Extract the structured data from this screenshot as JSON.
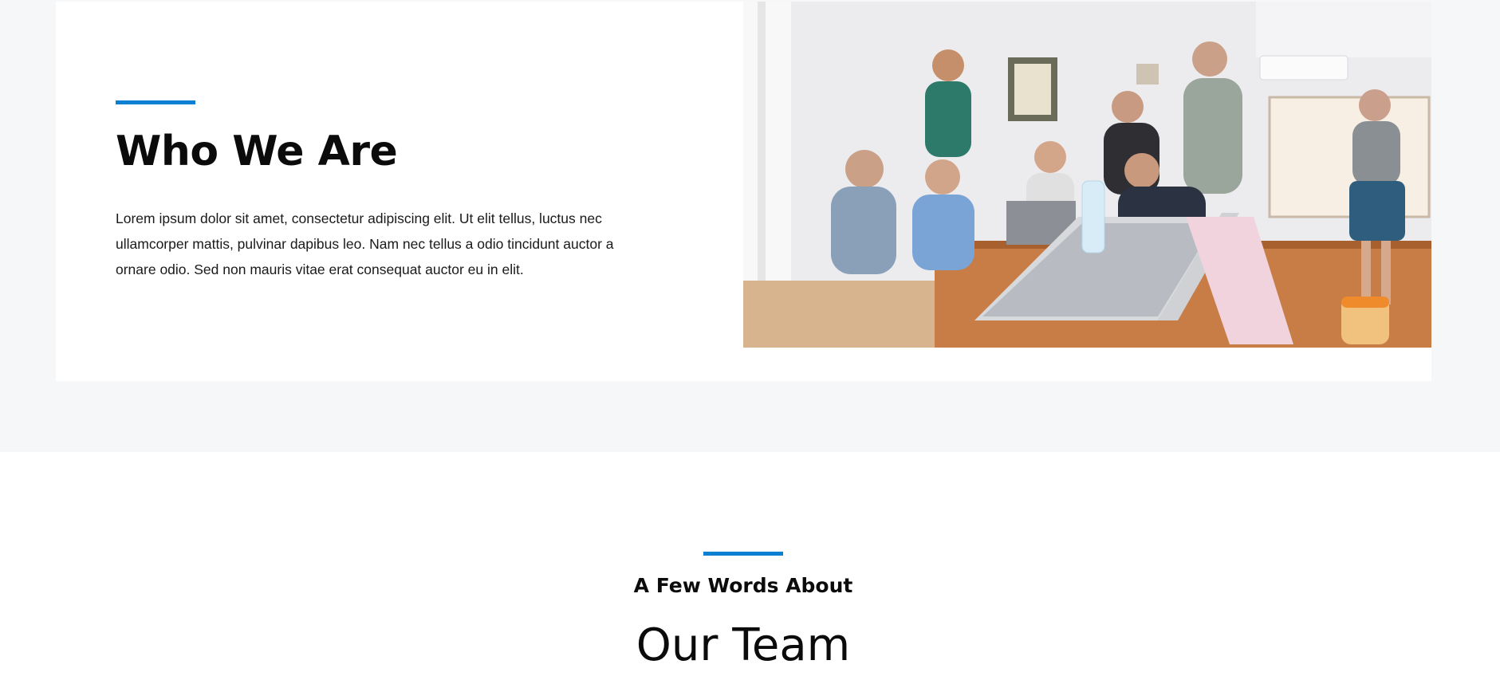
{
  "about": {
    "title": "Who We Are",
    "text": "Lorem ipsum dolor sit amet, consectetur adipiscing elit. Ut elit tellus, luctus nec ullamcorper mattis, pulvinar dapibus leo. Nam nec tellus a odio tincidunt auctor a ornare odio. Sed non mauris vitae erat consequat auctor eu in elit."
  },
  "team": {
    "kicker": "A Few Words About",
    "title": "Our Team"
  },
  "colors": {
    "accent": "#0b7fd1",
    "page_background": "#f6f7f9",
    "card_background": "#ffffff",
    "heading": "#0b0b0b"
  }
}
